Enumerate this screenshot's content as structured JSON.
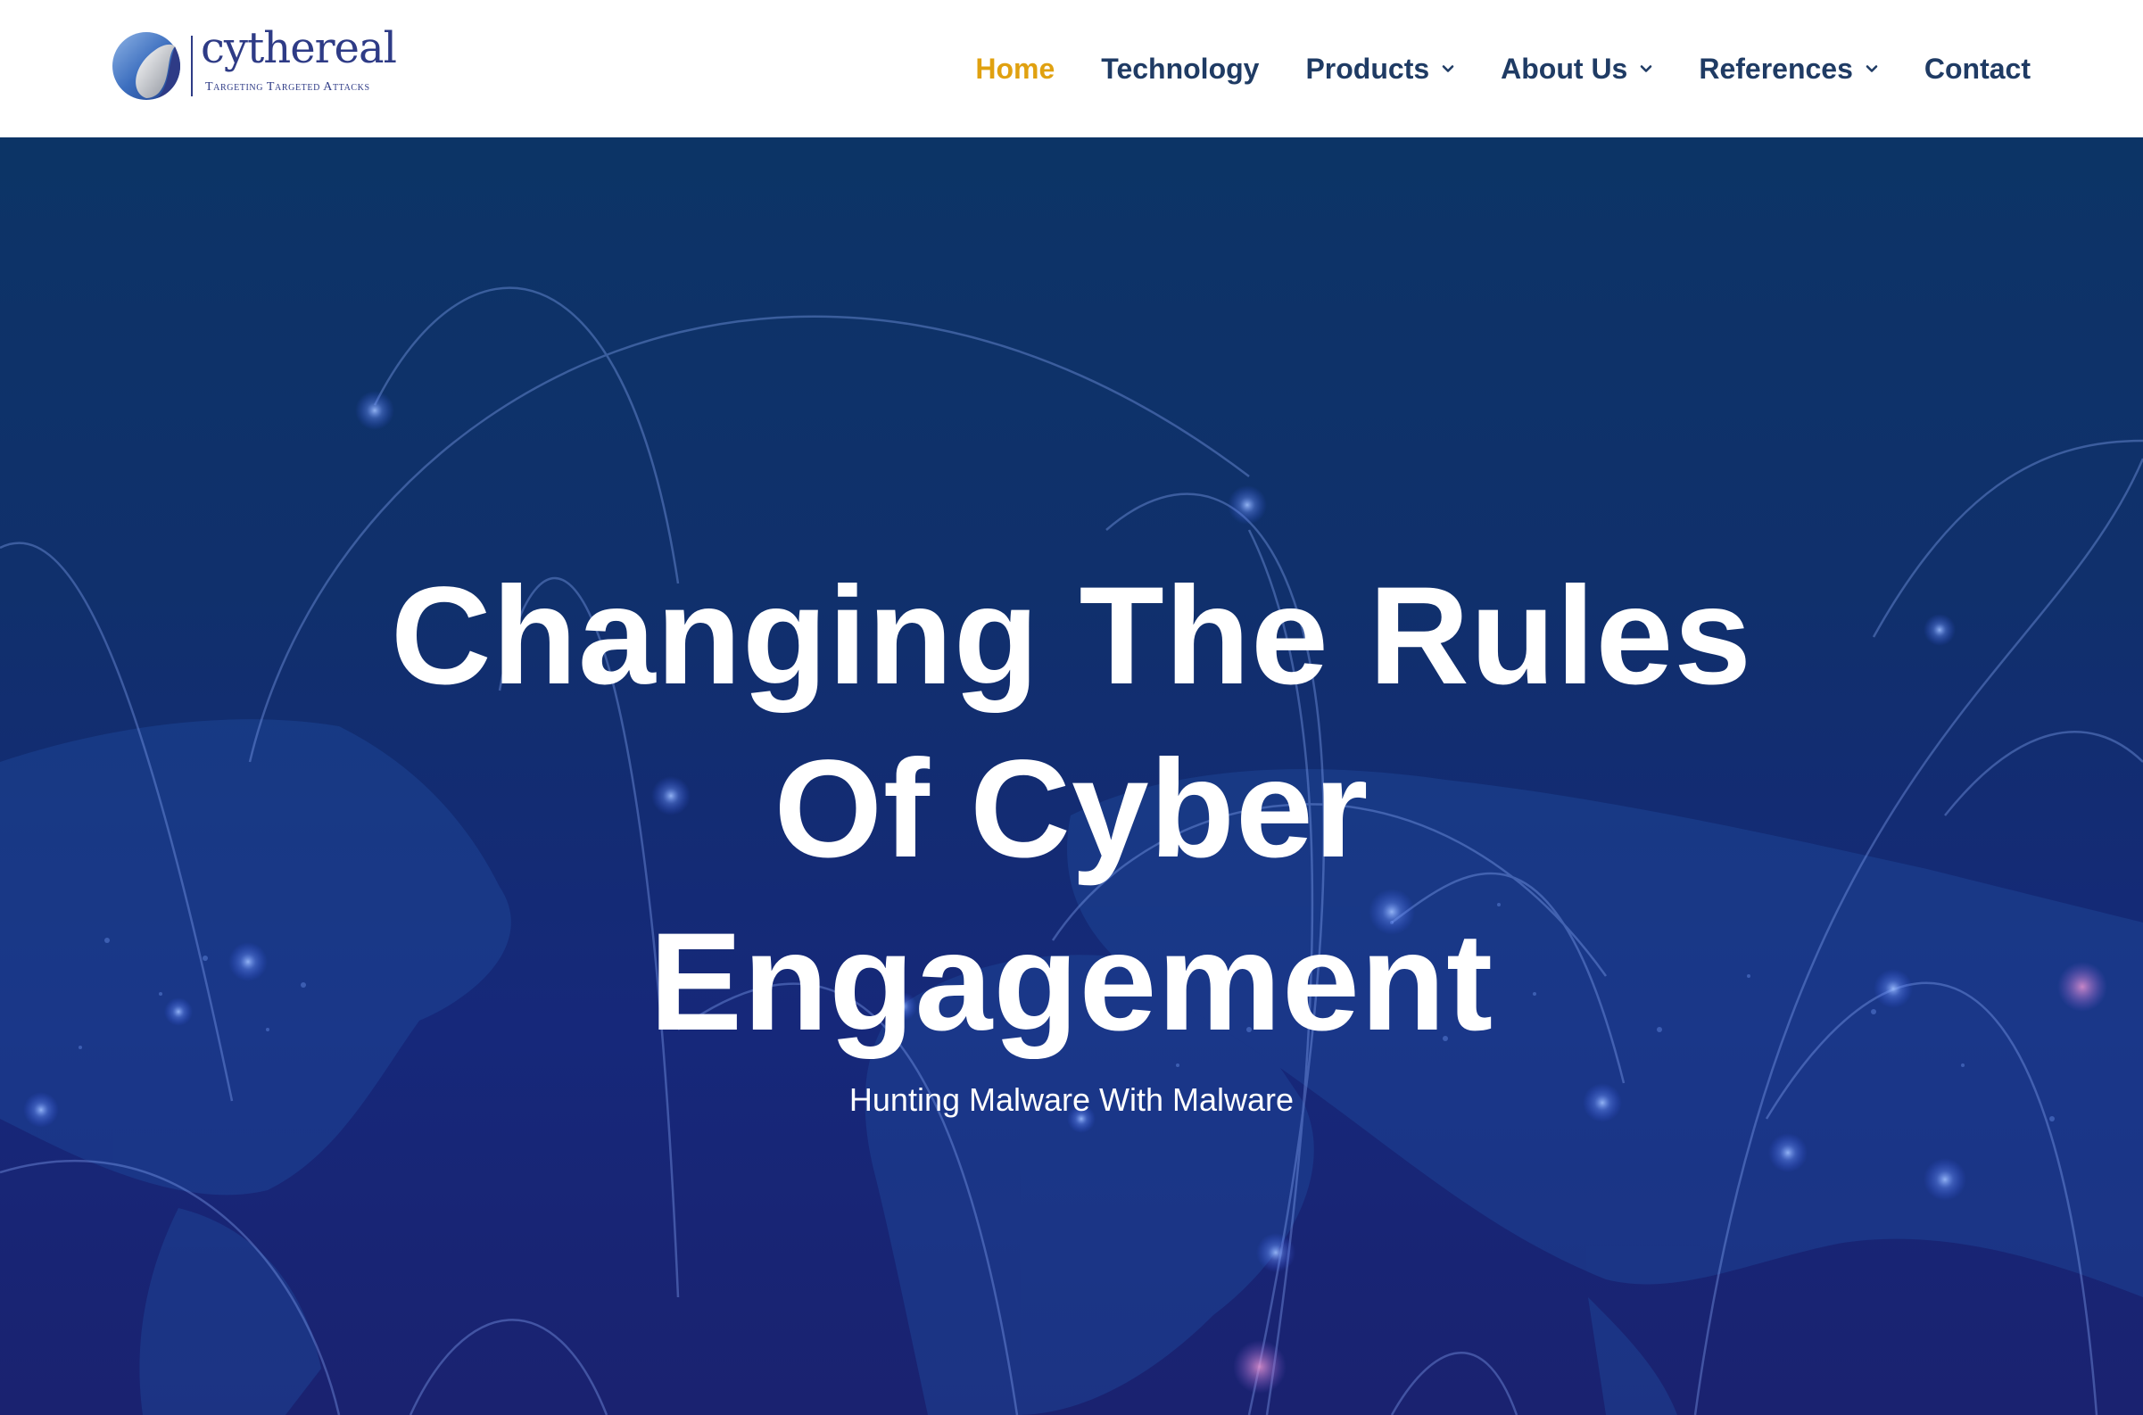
{
  "brand": {
    "name": "cythereal",
    "tagline": "Targeting Targeted Attacks"
  },
  "nav": {
    "items": [
      {
        "label": "Home",
        "active": true,
        "dropdown": false
      },
      {
        "label": "Technology",
        "active": false,
        "dropdown": false
      },
      {
        "label": "Products",
        "active": false,
        "dropdown": true
      },
      {
        "label": "About Us",
        "active": false,
        "dropdown": true
      },
      {
        "label": "References",
        "active": false,
        "dropdown": true
      },
      {
        "label": "Contact",
        "active": false,
        "dropdown": false
      }
    ]
  },
  "hero": {
    "title_lines": [
      "Changing The Rules",
      "Of Cyber",
      "Engagement"
    ],
    "subtitle": "Hunting Malware With Malware",
    "background_icon": "world-network-map"
  },
  "colors": {
    "nav_text": "#1f3b64",
    "nav_active": "#e0a110",
    "brand": "#2e3b86",
    "hero_top": "#0c3466",
    "hero_bottom": "#1a2270"
  }
}
